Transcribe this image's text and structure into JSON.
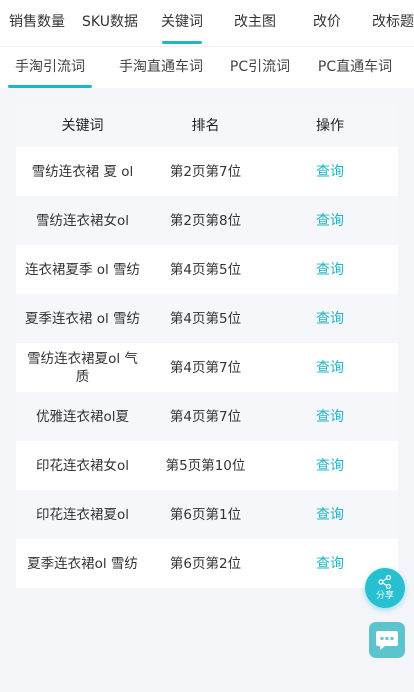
{
  "top_tabs": [
    {
      "label": "销售数量",
      "active": false
    },
    {
      "label": "SKU数据",
      "active": false
    },
    {
      "label": "关键词",
      "active": true
    },
    {
      "label": "改主图",
      "active": false
    },
    {
      "label": "改价",
      "active": false
    },
    {
      "label": "改标题",
      "active": false
    }
  ],
  "sub_tabs": [
    {
      "label": "手淘引流词",
      "active": true
    },
    {
      "label": "手淘直通车词",
      "active": false
    },
    {
      "label": "PC引流词",
      "active": false
    },
    {
      "label": "PC直通车词",
      "active": false
    }
  ],
  "table": {
    "headers": {
      "keyword": "关键词",
      "rank": "排名",
      "action": "操作"
    },
    "rows": [
      {
        "keyword": "雪纺连衣裙 夏 ol",
        "rank": "第2页第7位",
        "action": "查询"
      },
      {
        "keyword": "雪纺连衣裙女ol",
        "rank": "第2页第8位",
        "action": "查询"
      },
      {
        "keyword": "连衣裙夏季 ol 雪纺",
        "rank": "第4页第5位",
        "action": "查询"
      },
      {
        "keyword": "夏季连衣裙 ol 雪纺",
        "rank": "第4页第5位",
        "action": "查询"
      },
      {
        "keyword": "雪纺连衣裙夏ol 气质",
        "rank": "第4页第7位",
        "action": "查询"
      },
      {
        "keyword": "优雅连衣裙ol夏",
        "rank": "第4页第7位",
        "action": "查询"
      },
      {
        "keyword": "印花连衣裙女ol",
        "rank": "第5页第10位",
        "action": "查询"
      },
      {
        "keyword": "印花连衣裙夏ol",
        "rank": "第6页第1位",
        "action": "查询"
      },
      {
        "keyword": "夏季连衣裙ol 雪纺",
        "rank": "第6页第2位",
        "action": "查询"
      }
    ]
  },
  "float_buttons": {
    "share_label": "分享",
    "share_icon": "share-icon",
    "chat_icon": "chat-icon"
  },
  "colors": {
    "accent": "#1fb7c7",
    "background": "#f4f5f9"
  }
}
